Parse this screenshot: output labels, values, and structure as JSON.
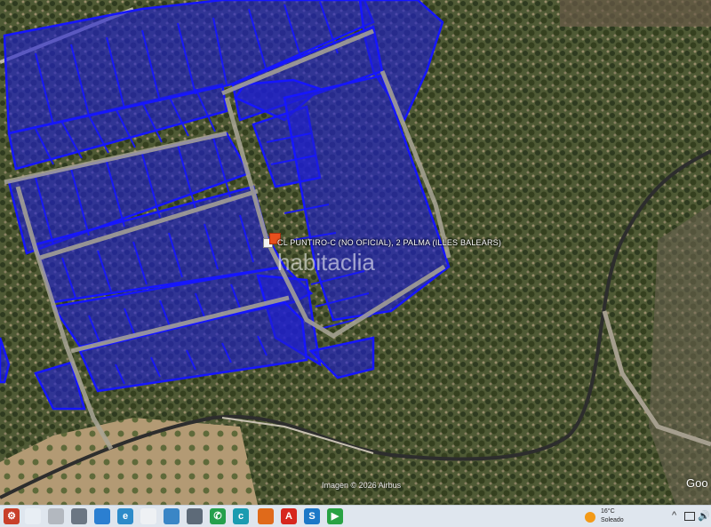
{
  "map": {
    "address_label": "CL PUNTIRO-C (NO OFICIAL), 2  PALMA (ILLES BALEARS)",
    "watermark": "habitaclia",
    "imagery_credit": "Imagen © 2026 Airbus",
    "provider_logo": "Goo"
  },
  "taskbar": {
    "apps": [
      {
        "name": "start-icon",
        "color": "#c8402a",
        "glyph": "⚙"
      },
      {
        "name": "file-icon",
        "color": "#e8eef4",
        "glyph": ""
      },
      {
        "name": "explorer-icon",
        "color": "#b3b8bf",
        "glyph": ""
      },
      {
        "name": "folder-icon",
        "color": "#6b7683",
        "glyph": ""
      },
      {
        "name": "photos-icon",
        "color": "#2b7fd1",
        "glyph": ""
      },
      {
        "name": "edge-icon",
        "color": "#2d8bc9",
        "glyph": "e"
      },
      {
        "name": "notes-icon",
        "color": "#eef1f4",
        "glyph": ""
      },
      {
        "name": "store-icon",
        "color": "#3a86c6",
        "glyph": ""
      },
      {
        "name": "app-icon",
        "color": "#5d6a78",
        "glyph": ""
      },
      {
        "name": "whatsapp-icon",
        "color": "#25a04c",
        "glyph": "✆"
      },
      {
        "name": "chrome-like-icon",
        "color": "#1a9bb0",
        "glyph": "c"
      },
      {
        "name": "firefox-icon",
        "color": "#e06a1a",
        "glyph": ""
      },
      {
        "name": "acrobat-icon",
        "color": "#d7261e",
        "glyph": "A"
      },
      {
        "name": "s-app-icon",
        "color": "#1c78c7",
        "glyph": "S"
      },
      {
        "name": "green-app-icon",
        "color": "#29a243",
        "glyph": "▶"
      }
    ],
    "weather": {
      "temperature": "16°C",
      "condition": "Soleado"
    },
    "tray": {
      "arrow": "^",
      "speaker": "🔊"
    }
  }
}
